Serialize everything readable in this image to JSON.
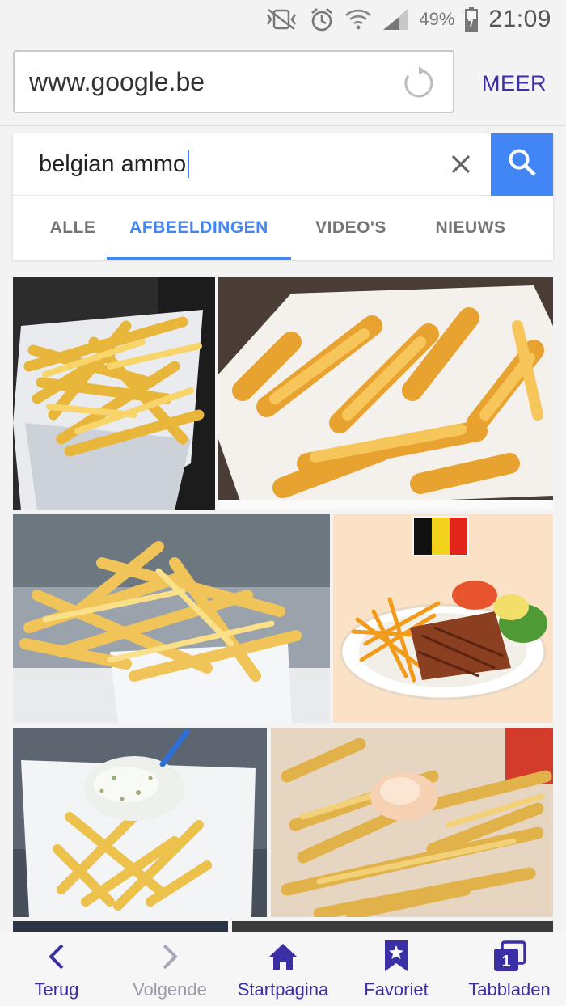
{
  "status_bar": {
    "icons": [
      "mute-vibrate-icon",
      "alarm-icon",
      "wifi-icon",
      "signal-icon"
    ],
    "battery": "49%",
    "time": "21:09"
  },
  "browser": {
    "url": "www.google.be",
    "more_label": "MEER"
  },
  "search": {
    "query": "belgian ammo",
    "tabs": [
      {
        "label": "ALLE",
        "active": false
      },
      {
        "label": "AFBEELDINGEN",
        "active": true
      },
      {
        "label": "VIDEO'S",
        "active": false
      },
      {
        "label": "NIEUWS",
        "active": false
      }
    ]
  },
  "results": [
    {
      "subject": "fries-in-paper-cone"
    },
    {
      "subject": "thick-cut-fries-plate"
    },
    {
      "subject": "fries-in-paper-tray"
    },
    {
      "subject": "fries-with-steak-and-belgian-flag"
    },
    {
      "subject": "fries-with-tartar-sauce"
    },
    {
      "subject": "fries-with-mayonnaise"
    }
  ],
  "colors": {
    "accent_blue": "#4285f4",
    "nav_purple": "#3b2fa6",
    "fries_gold": "#f2c14a"
  },
  "bottom_nav": [
    {
      "label": "Terug",
      "icon": "chevron-left-icon",
      "enabled": true
    },
    {
      "label": "Volgende",
      "icon": "chevron-right-icon",
      "enabled": false
    },
    {
      "label": "Startpagina",
      "icon": "home-icon",
      "enabled": true
    },
    {
      "label": "Favoriet",
      "icon": "bookmark-star-icon",
      "enabled": true
    },
    {
      "label": "Tabbladen",
      "icon": "tabs-icon",
      "enabled": true
    }
  ]
}
